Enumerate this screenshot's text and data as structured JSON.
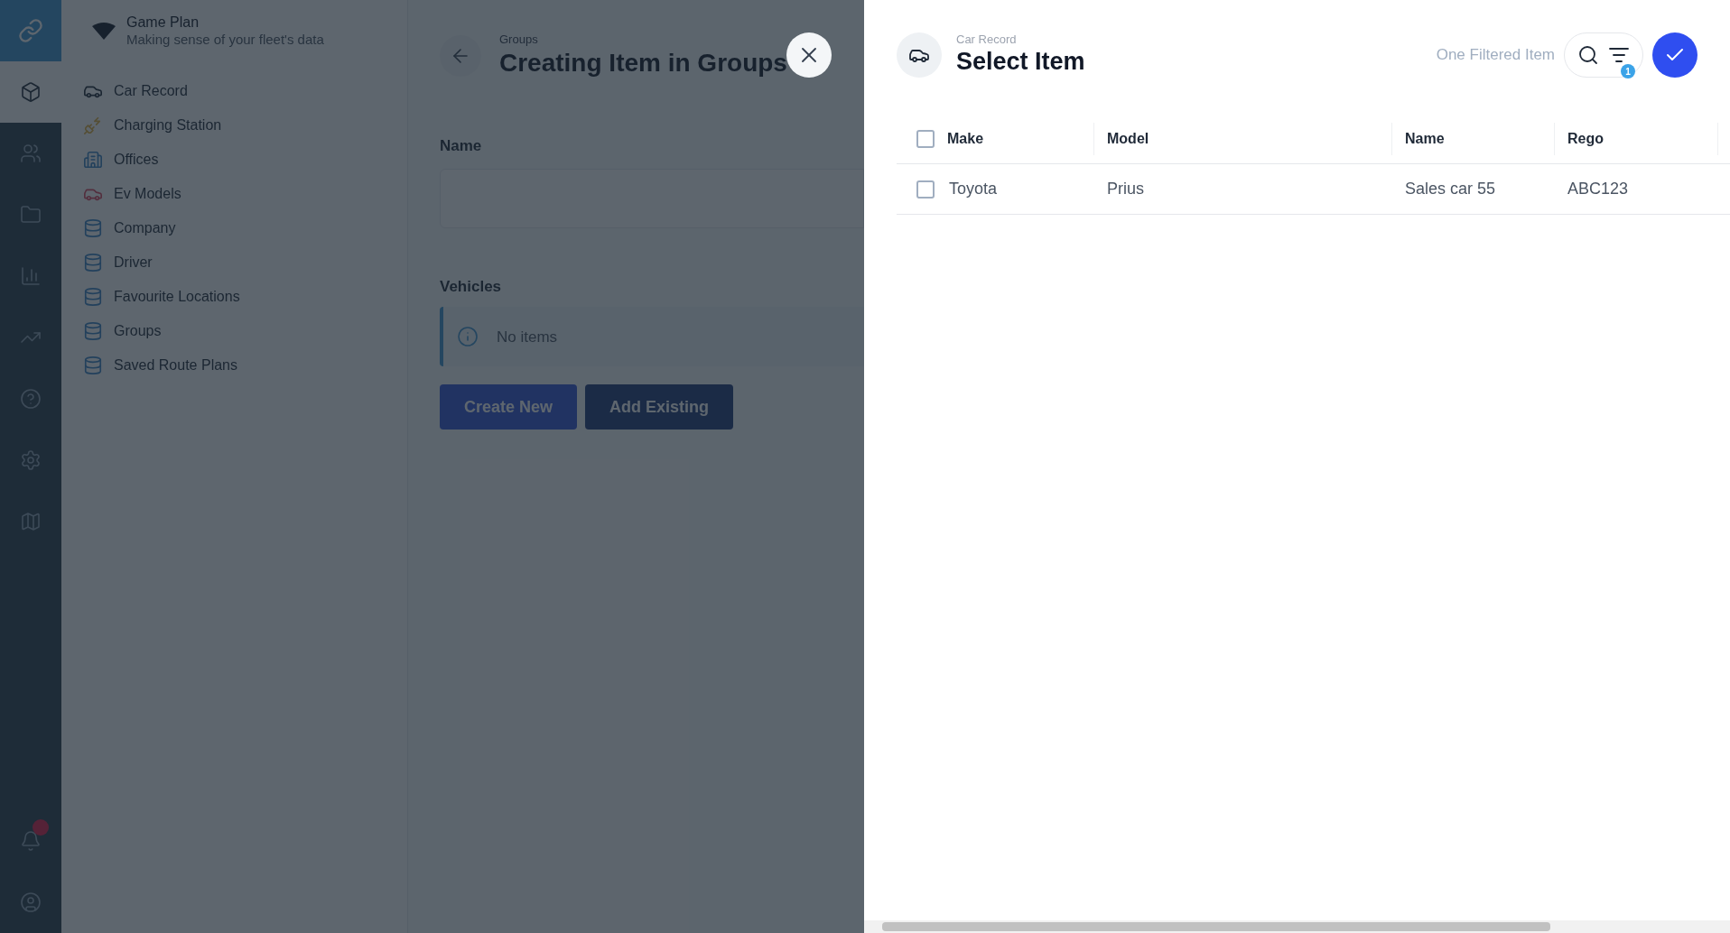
{
  "rail": {
    "logo": {
      "kind": "link"
    },
    "items": [
      {
        "kind": "box",
        "selected": true
      },
      {
        "kind": "users",
        "selected": false
      },
      {
        "kind": "folder",
        "selected": false
      },
      {
        "kind": "chart",
        "selected": false
      },
      {
        "kind": "trend",
        "selected": false
      },
      {
        "kind": "help",
        "selected": false
      },
      {
        "kind": "settings",
        "selected": false
      },
      {
        "kind": "map",
        "selected": false
      }
    ],
    "bottom": [
      {
        "kind": "bell",
        "badge": true
      },
      {
        "kind": "user",
        "badge": false
      }
    ]
  },
  "nav": {
    "title": "Game Plan",
    "subtitle": "Making sense of your fleet's data",
    "items": [
      {
        "label": "Car Record",
        "kind": "car"
      },
      {
        "label": "Charging Station",
        "kind": "charging"
      },
      {
        "label": "Offices",
        "kind": "building"
      },
      {
        "label": "Ev Models",
        "kind": "ev"
      },
      {
        "label": "Company",
        "kind": "database"
      },
      {
        "label": "Driver",
        "kind": "database"
      },
      {
        "label": "Favourite Locations",
        "kind": "database"
      },
      {
        "label": "Groups",
        "kind": "database"
      },
      {
        "label": "Saved Route Plans",
        "kind": "database"
      }
    ]
  },
  "form": {
    "breadcrumb": "Groups",
    "title": "Creating Item in Groups",
    "fields": [
      {
        "label": "Name"
      }
    ],
    "section": "Vehicles",
    "notice": "No items",
    "buttons": [
      {
        "label": "Create New",
        "kind": "primary"
      },
      {
        "label": "Add Existing",
        "kind": "secondary"
      }
    ]
  },
  "drawer": {
    "breadcrumb": "Car Record",
    "title": "Select Item",
    "filter_summary": "One Filtered Item",
    "filter_count": "1",
    "table": {
      "all_checked": false,
      "columns": [
        "Make",
        "Model",
        "Name",
        "Rego"
      ],
      "rows": [
        {
          "checked": false,
          "cells": [
            "Toyota",
            "Prius",
            "Sales car 55",
            "ABC123"
          ]
        }
      ]
    }
  }
}
